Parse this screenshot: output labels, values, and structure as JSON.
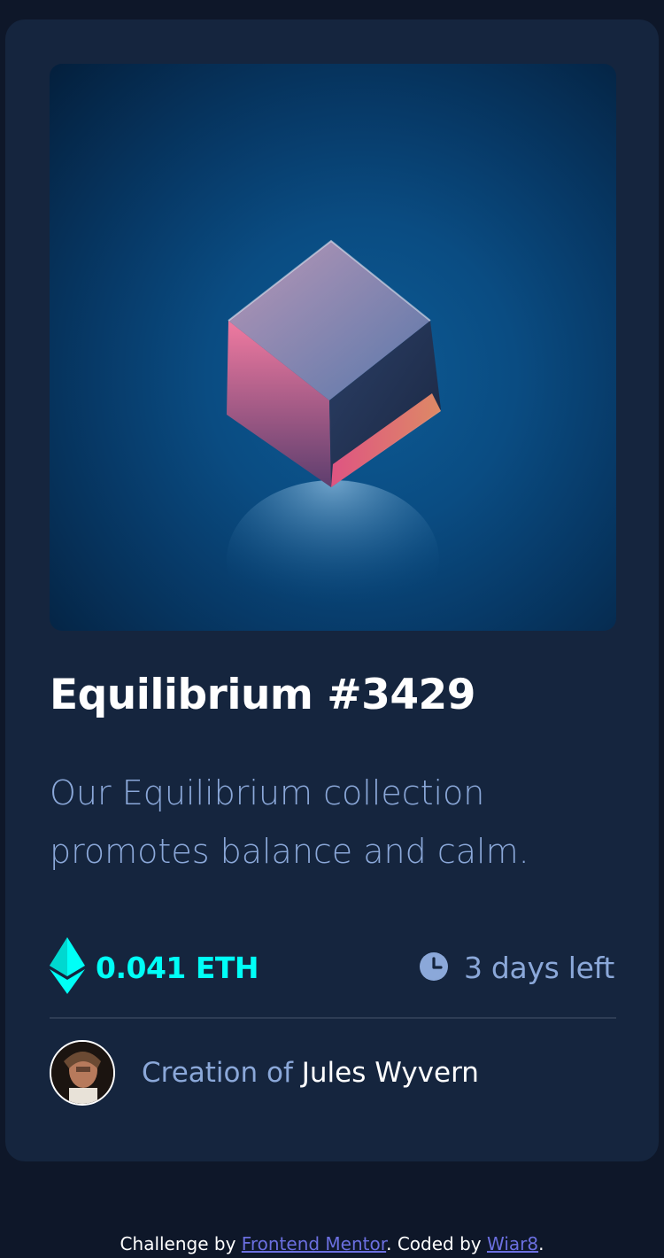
{
  "card": {
    "image_alt": "Equilibrium crystal cube",
    "title": "Equilibrium #3429",
    "description": "Our Equilibrium collection promotes balance and calm.",
    "price": "0.041 ETH",
    "time_left": "3 days left",
    "creator_prefix": "Creation of ",
    "creator_name": "Jules Wyvern"
  },
  "footer": {
    "prefix": "Challenge by ",
    "challenge_link": "Frontend Mentor",
    "middle": ". Coded by ",
    "coder_link": "Wiar8",
    "suffix": "."
  },
  "icons": {
    "eth": "ethereum-icon",
    "clock": "clock-icon"
  },
  "colors": {
    "background": "#0e1729",
    "card": "#15253e",
    "cyan": "#00fff7",
    "soft_blue": "#8ba8d9",
    "white": "#ffffff",
    "link": "#6b6fe0"
  }
}
